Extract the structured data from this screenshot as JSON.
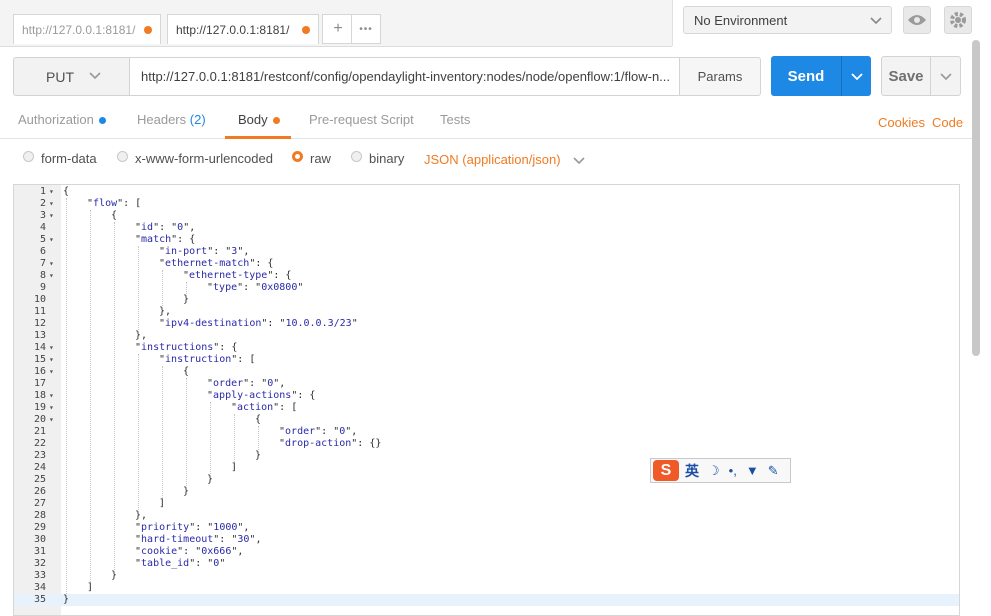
{
  "tabs": [
    {
      "label": "http://127.0.0.1:8181/",
      "active": false
    },
    {
      "label": "http://127.0.0.1:8181/",
      "active": true
    }
  ],
  "tab_actions": {
    "add": "+",
    "more": "•••"
  },
  "environment": {
    "selected": "No Environment",
    "icons": [
      "eye-icon",
      "gear-icon"
    ]
  },
  "request": {
    "method": "PUT",
    "url": "http://127.0.0.1:8181/restconf/config/opendaylight-inventory:nodes/node/openflow:1/flow-n...",
    "params_label": "Params",
    "send_label": "Send",
    "save_label": "Save"
  },
  "subtabs": [
    {
      "label": "Authorization",
      "badge": "dot"
    },
    {
      "label": "Headers",
      "count": "(2)"
    },
    {
      "label": "Body",
      "badge": "dot",
      "active": true
    },
    {
      "label": "Pre-request Script"
    },
    {
      "label": "Tests"
    }
  ],
  "links": {
    "cookies": "Cookies",
    "code": "Code"
  },
  "body_types": [
    {
      "label": "form-data",
      "selected": false
    },
    {
      "label": "x-www-form-urlencoded",
      "selected": false
    },
    {
      "label": "raw",
      "selected": true
    },
    {
      "label": "binary",
      "selected": false
    }
  ],
  "content_type": "JSON (application/json)",
  "editor_lines": [
    {
      "n": "1",
      "fold": true,
      "indent": 0,
      "text": "{"
    },
    {
      "n": "2",
      "fold": true,
      "indent": 1,
      "text": "\"flow\": ["
    },
    {
      "n": "3",
      "fold": true,
      "indent": 2,
      "text": "{"
    },
    {
      "n": "4",
      "fold": false,
      "indent": 3,
      "text": "\"id\": \"0\","
    },
    {
      "n": "5",
      "fold": true,
      "indent": 3,
      "text": "\"match\": {"
    },
    {
      "n": "6",
      "fold": false,
      "indent": 4,
      "text": "\"in-port\": \"3\","
    },
    {
      "n": "7",
      "fold": true,
      "indent": 4,
      "text": "\"ethernet-match\": {"
    },
    {
      "n": "8",
      "fold": true,
      "indent": 5,
      "text": "\"ethernet-type\": {"
    },
    {
      "n": "9",
      "fold": false,
      "indent": 6,
      "text": "\"type\": \"0x0800\""
    },
    {
      "n": "10",
      "fold": false,
      "indent": 5,
      "text": "}"
    },
    {
      "n": "11",
      "fold": false,
      "indent": 4,
      "text": "},"
    },
    {
      "n": "12",
      "fold": false,
      "indent": 4,
      "text": "\"ipv4-destination\": \"10.0.0.3/23\""
    },
    {
      "n": "13",
      "fold": false,
      "indent": 3,
      "text": "},"
    },
    {
      "n": "14",
      "fold": true,
      "indent": 3,
      "text": "\"instructions\": {"
    },
    {
      "n": "15",
      "fold": true,
      "indent": 4,
      "text": "\"instruction\": ["
    },
    {
      "n": "16",
      "fold": true,
      "indent": 5,
      "text": "{"
    },
    {
      "n": "17",
      "fold": false,
      "indent": 6,
      "text": "\"order\": \"0\","
    },
    {
      "n": "18",
      "fold": true,
      "indent": 6,
      "text": "\"apply-actions\": {"
    },
    {
      "n": "19",
      "fold": true,
      "indent": 7,
      "text": "\"action\": ["
    },
    {
      "n": "20",
      "fold": true,
      "indent": 8,
      "text": "{"
    },
    {
      "n": "21",
      "fold": false,
      "indent": 9,
      "text": "\"order\": \"0\","
    },
    {
      "n": "22",
      "fold": false,
      "indent": 9,
      "text": "\"drop-action\": {}"
    },
    {
      "n": "23",
      "fold": false,
      "indent": 8,
      "text": "}"
    },
    {
      "n": "24",
      "fold": false,
      "indent": 7,
      "text": "]"
    },
    {
      "n": "25",
      "fold": false,
      "indent": 6,
      "text": "}"
    },
    {
      "n": "26",
      "fold": false,
      "indent": 5,
      "text": "}"
    },
    {
      "n": "27",
      "fold": false,
      "indent": 4,
      "text": "]"
    },
    {
      "n": "28",
      "fold": false,
      "indent": 3,
      "text": "},"
    },
    {
      "n": "29",
      "fold": false,
      "indent": 3,
      "text": "\"priority\": \"1000\","
    },
    {
      "n": "30",
      "fold": false,
      "indent": 3,
      "text": "\"hard-timeout\": \"30\","
    },
    {
      "n": "31",
      "fold": false,
      "indent": 3,
      "text": "\"cookie\": \"0x666\","
    },
    {
      "n": "32",
      "fold": false,
      "indent": 3,
      "text": "\"table_id\": \"0\""
    },
    {
      "n": "33",
      "fold": false,
      "indent": 2,
      "text": "}"
    },
    {
      "n": "34",
      "fold": false,
      "indent": 1,
      "text": "]"
    },
    {
      "n": "35",
      "fold": false,
      "indent": 0,
      "text": "}"
    }
  ],
  "ime_toolbar": {
    "logo": "S",
    "lang": "英",
    "icons": [
      "moon-icon",
      "punctuation-icon",
      "shirt-icon",
      "wrench-icon"
    ]
  },
  "colors": {
    "accent": "#f07b22",
    "primary": "#1e88e5"
  }
}
